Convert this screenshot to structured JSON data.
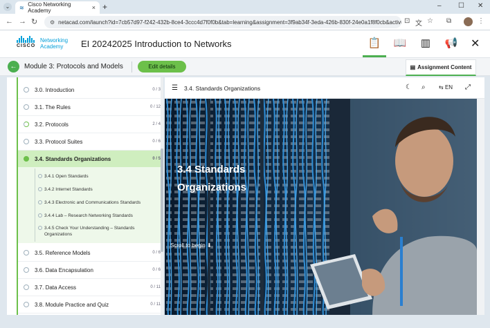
{
  "browser": {
    "tab_title": "Cisco Networking Academy",
    "tab_close": "×",
    "new_tab": "+",
    "url": "netacad.com/launch?id=7cb57d97-f242-432b-8ce4-3ccc4d7f0f0b&tab=learning&assignment=3f9ab34f-3eda-426b-830f-24e0a1f8f0cb&activity=...",
    "minimize": "–",
    "maximize": "☐",
    "close": "✕"
  },
  "app": {
    "brand_line1": "Networking",
    "brand_line2": "Academy",
    "cisco_word": "CISCO",
    "course_title": "EI 20242025 Introduction to Networks"
  },
  "module": {
    "title": "Module 3: Protocols and Models",
    "edit_label": "Edit details",
    "assignment_tab": "Assignment Content"
  },
  "sidebar": {
    "items": [
      {
        "label": "3.0. Introduction",
        "progress": "0 / 3"
      },
      {
        "label": "3.1. The Rules",
        "progress": "0 / 12"
      },
      {
        "label": "3.2. Protocols",
        "progress": "2 / 4"
      },
      {
        "label": "3.3. Protocol Suites",
        "progress": "0 / 6"
      },
      {
        "label": "3.4. Standards Organizations",
        "progress": "0 / 5"
      },
      {
        "label": "3.5. Reference Models",
        "progress": "0 / 6"
      },
      {
        "label": "3.6. Data Encapsulation",
        "progress": "0 / 6"
      },
      {
        "label": "3.7. Data Access",
        "progress": "0 / 11"
      },
      {
        "label": "3.8. Module Practice and Quiz",
        "progress": "0 / 11"
      }
    ],
    "subitems": [
      "3.4.1 Open Standards",
      "3.4.2 Internet Standards",
      "3.4.3 Electronic and Communications Standards",
      "3.4.4 Lab – Research Networking Standards",
      "3.4.5 Check Your Understanding – Standards Organizations"
    ]
  },
  "content": {
    "toolbar_title": "3.4. Standards Organizations",
    "lang": "EN",
    "hero_title": "3.4 Standards Organizations",
    "scroll_hint": "Scroll to begin"
  }
}
